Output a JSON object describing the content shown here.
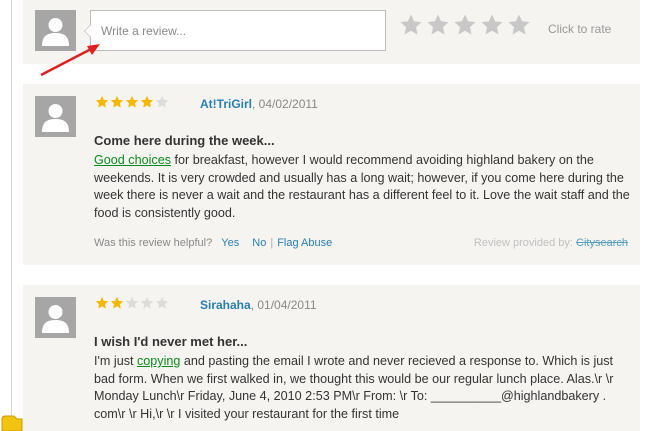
{
  "compose": {
    "placeholder": "Write a review...",
    "click_to_rate": "Click to rate",
    "rate_star_count": 5
  },
  "reviews": [
    {
      "rating": 4,
      "max_rating": 5,
      "author": "At!TriGirl",
      "date": ", 04/02/2011",
      "title": "Come here during the week...",
      "body_highlight": "Good choices",
      "body_rest": " for breakfast, however I would recommend avoiding highland bakery on the weekends. It is very crowded and usually has a long wait; however, if you come here during the week there is never a wait and the restaurant has a different feel to it. Love the wait staff and the food is consistently good.",
      "helpful_prompt": "Was this review helpful?",
      "yes": "Yes",
      "no": "No",
      "separator": "|",
      "flag": "Flag Abuse",
      "provided_by": "Review provided by:",
      "provider": "Citysearch"
    },
    {
      "rating": 2,
      "max_rating": 5,
      "author": "Sirahaha",
      "date": ", 01/04/2011",
      "title": "I wish I'd never met her...",
      "body_intro": "I'm just ",
      "body_highlight": "copying",
      "body_rest": " and pasting the email I wrote and never recieved a response to. Which is just bad form. When we first walked in, we thought this would be our regular lunch place. Alas.\\r \\r Monday Lunch\\r Friday, June 4, 2010 2:53 PM\\r From: \\r To: __________@highlandbakery . com\\r \\r Hi,\\r \\r I visited your restaurant for the first time"
    }
  ],
  "colors": {
    "card_bg": "#f5f4f1",
    "star_filled": "#f5b700",
    "star_empty": "#dcdcdc",
    "rate_star": "#c8c8c8",
    "link": "#2a7fb0",
    "highlight": "#0d8a1f",
    "arrow": "#e02020"
  }
}
